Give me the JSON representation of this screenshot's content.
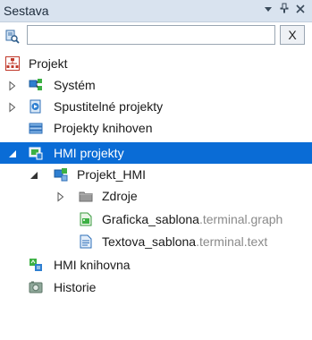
{
  "panel": {
    "title": "Sestava"
  },
  "search": {
    "value": "",
    "clear_label": "X"
  },
  "tree": {
    "root": {
      "label": "Projekt"
    },
    "system": {
      "label": "Systém"
    },
    "executable": {
      "label": "Spustitelné projekty"
    },
    "libraries": {
      "label": "Projekty knihoven"
    },
    "hmi": {
      "label": "HMI projekty"
    },
    "projekt_hmi": {
      "label": "Projekt_HMI"
    },
    "zdroje": {
      "label": "Zdroje"
    },
    "graficka": {
      "name": "Graficka_sablona",
      "ext": ".terminal.graph"
    },
    "textova": {
      "name": "Textova_sablona",
      "ext": ".terminal.text"
    },
    "hmi_lib": {
      "label": "HMI knihovna"
    },
    "historie": {
      "label": "Historie"
    }
  },
  "colors": {
    "selection": "#0a6cd6",
    "titlebar": "#d9e3ef",
    "extension_text": "#8a8a8a"
  }
}
